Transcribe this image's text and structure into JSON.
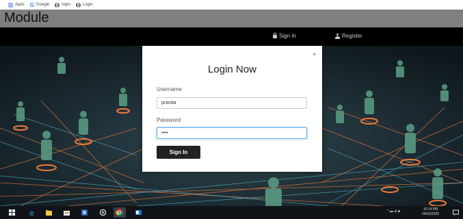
{
  "bookmarks": [
    {
      "label": "Apps",
      "icon": "apps-icon"
    },
    {
      "label": "Google",
      "icon": "google-icon"
    },
    {
      "label": "login",
      "icon": "globe-icon"
    },
    {
      "label": "Login",
      "icon": "globe-icon"
    }
  ],
  "header": {
    "title": "Module"
  },
  "nav": {
    "signin_label": "Sign In",
    "register_label": "Register"
  },
  "modal": {
    "close": "×",
    "title": "Login Now",
    "username_label": "Username",
    "username_value": "pranita",
    "password_label": "Password",
    "password_value": "••••",
    "submit_label": "Sign In"
  },
  "taskbar": {
    "time": "10:14 PM",
    "date": "04/02/2020"
  },
  "colors": {
    "accent_focus": "#66afe9",
    "button": "#222222",
    "nav": "#000000"
  }
}
